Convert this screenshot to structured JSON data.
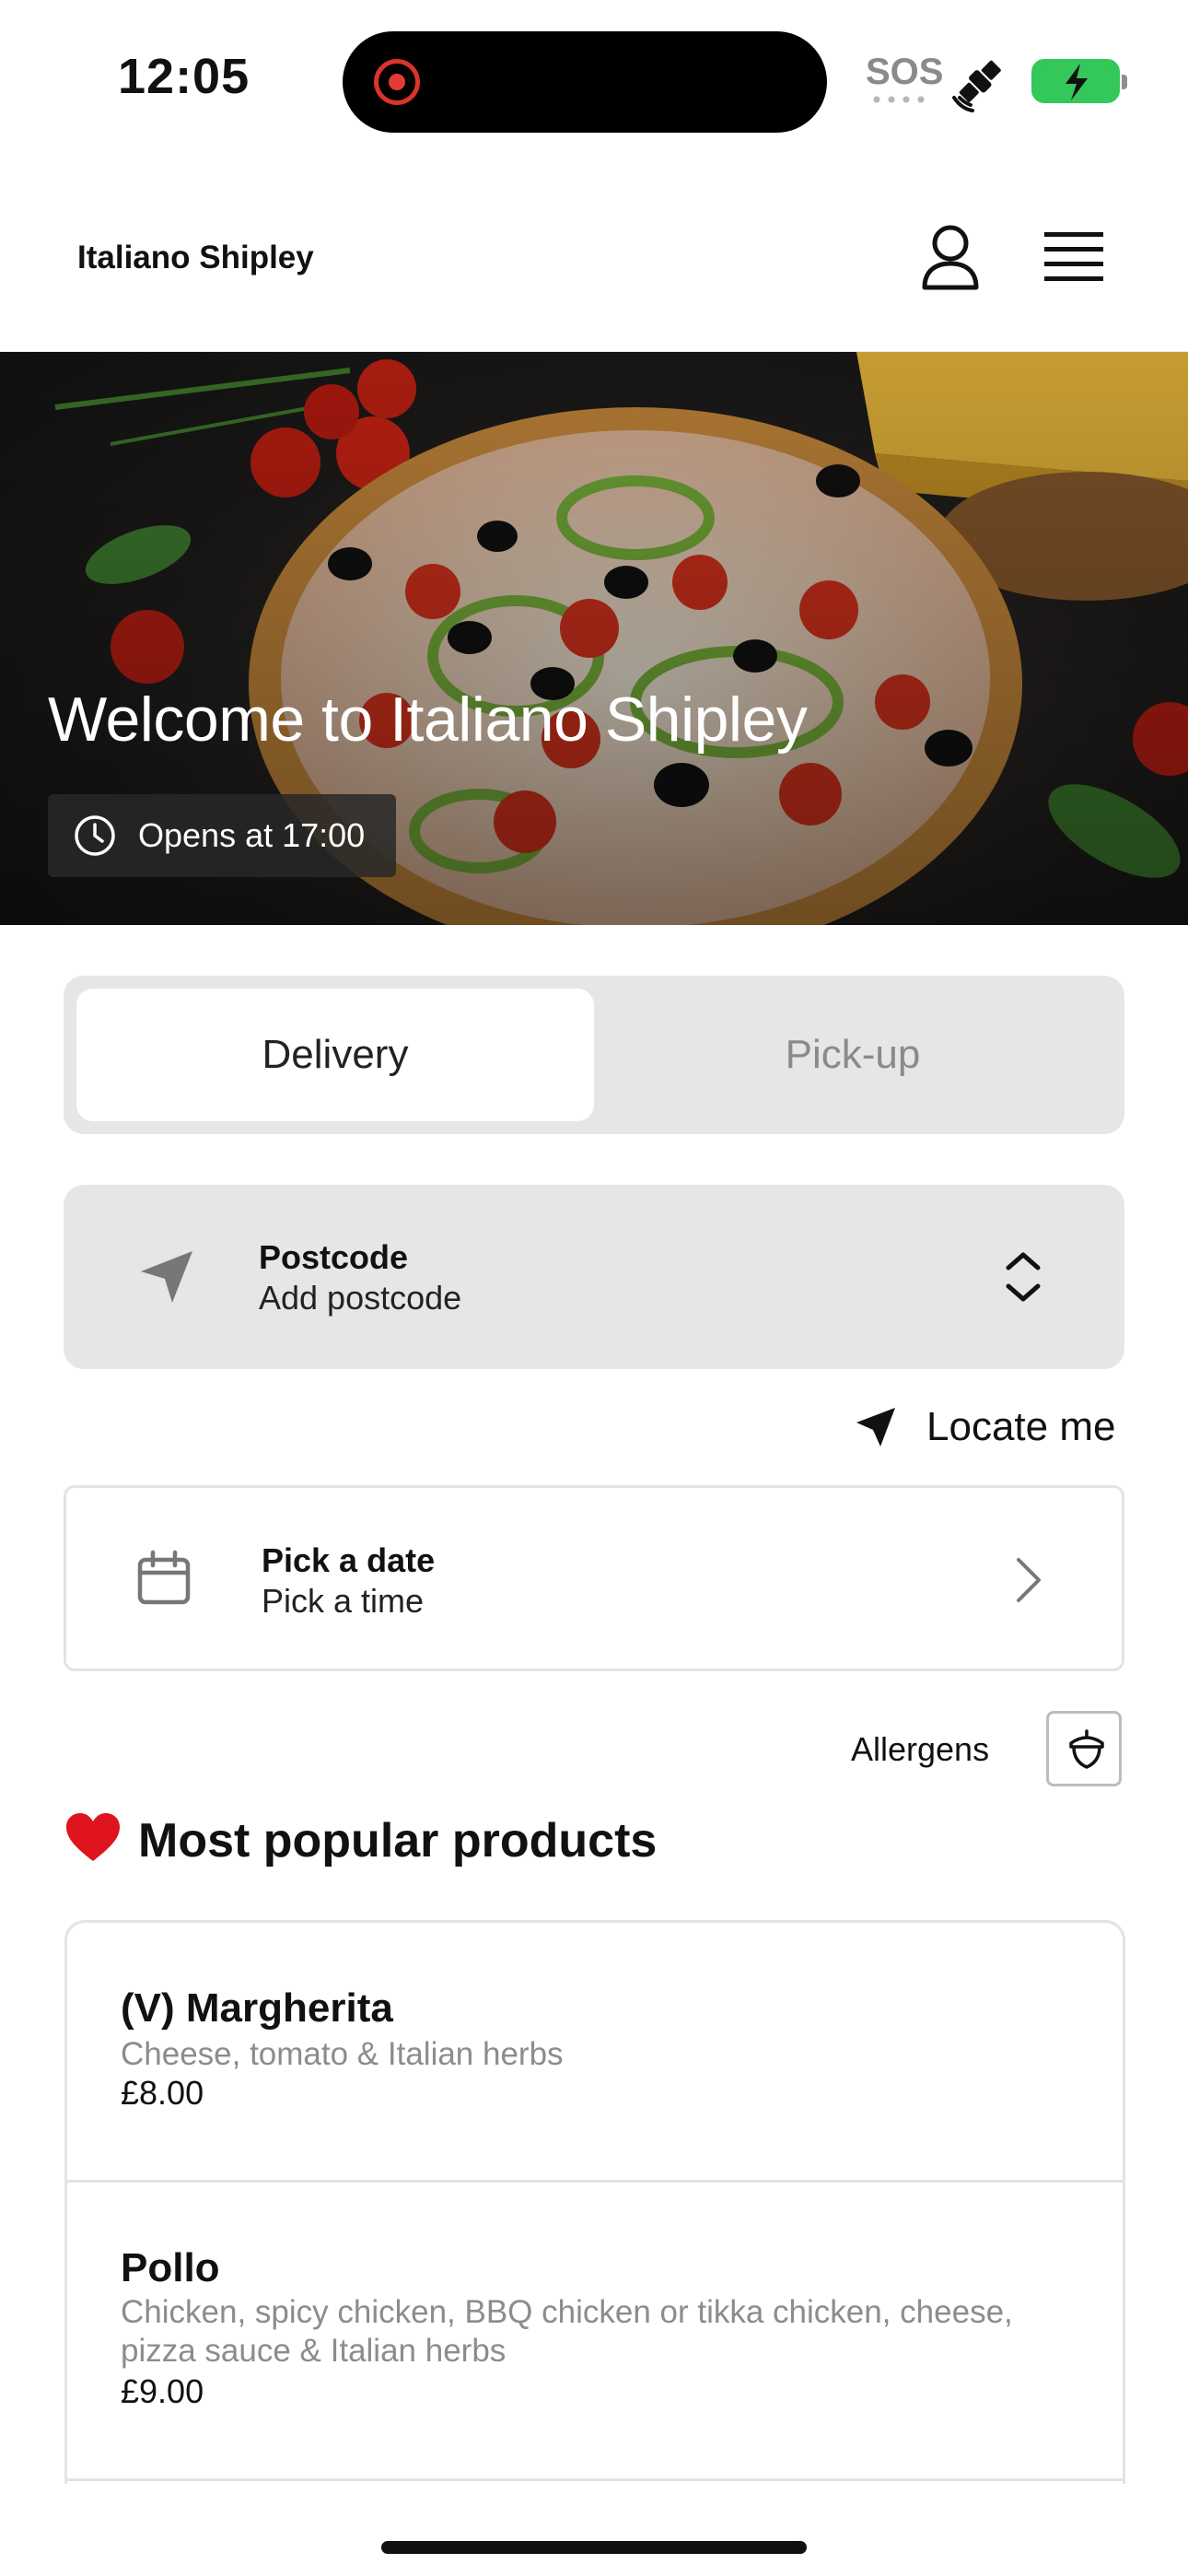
{
  "status_bar": {
    "time": "12:05",
    "sos": "SOS",
    "icons": [
      "screen-recording-icon",
      "satellite-icon",
      "battery-charging-icon"
    ]
  },
  "header": {
    "brand": "Italiano Shipley",
    "icons": [
      "account-icon",
      "menu-icon"
    ]
  },
  "hero": {
    "title": "Welcome to Italiano Shipley",
    "hours": "Opens at 17:00"
  },
  "order_mode": {
    "options": [
      "Delivery",
      "Pick-up"
    ],
    "selected": "Delivery"
  },
  "postcode": {
    "label": "Postcode",
    "value": "Add postcode"
  },
  "locate": {
    "label": "Locate me"
  },
  "schedule": {
    "date_label": "Pick a date",
    "time_label": "Pick a time"
  },
  "allergens": {
    "label": "Allergens"
  },
  "popular": {
    "emoji": "❤️",
    "title": "Most popular products"
  },
  "products": [
    {
      "name": "(V) Margherita",
      "description": "Cheese, tomato & Italian herbs",
      "price": "£8.00"
    },
    {
      "name": "Pollo",
      "description": "Chicken, spicy chicken, BBQ chicken or tikka chicken, cheese, pizza sauce & Italian herbs",
      "price": "£9.00"
    }
  ],
  "colors": {
    "battery": "#34c759",
    "recording": "#e53935",
    "panel_gray": "#e6e6e6",
    "muted_text": "#8c8c8c"
  }
}
